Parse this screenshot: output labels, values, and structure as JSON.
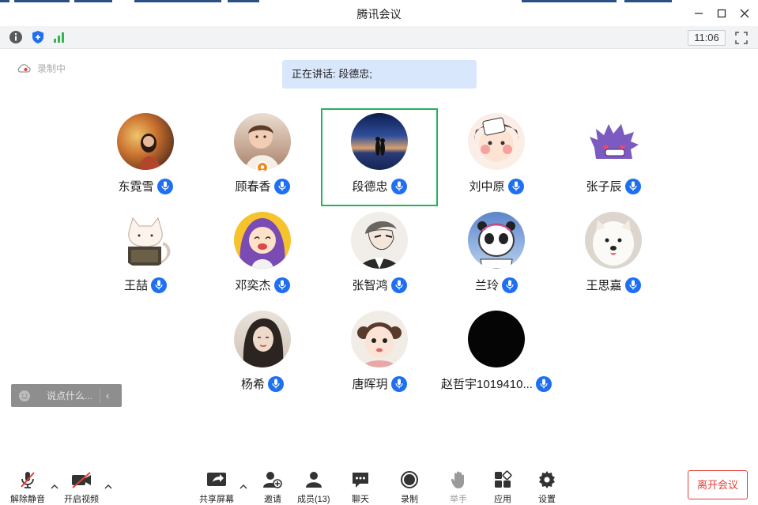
{
  "window": {
    "title": "腾讯会议"
  },
  "infobar": {
    "time": "11:06"
  },
  "recording": {
    "label": "录制中"
  },
  "speaking": {
    "text": "正在讲话: 段德忠;"
  },
  "participants": [
    {
      "name": "东霓雪",
      "avatar": "photo-girl-autumn"
    },
    {
      "name": "顾春香",
      "avatar": "photo-baby"
    },
    {
      "name": "段德忠",
      "avatar": "photo-couple-sunset"
    },
    {
      "name": "刘中原",
      "avatar": "cartoon-girl"
    },
    {
      "name": "张子辰",
      "avatar": "purple-ghost"
    },
    {
      "name": "王喆",
      "avatar": "cartoon-cat"
    },
    {
      "name": "邓奕杰",
      "avatar": "anime-purple-hair"
    },
    {
      "name": "张智鸿",
      "avatar": "sketch-man"
    },
    {
      "name": "兰玲",
      "avatar": "panda-mascot"
    },
    {
      "name": "王思嘉",
      "avatar": "white-dog"
    },
    {
      "name": "杨希",
      "avatar": "photo-woman"
    },
    {
      "name": "唐晖玥",
      "avatar": "photo-child"
    },
    {
      "name": "赵哲宇1019410...",
      "avatar": "black"
    }
  ],
  "chat": {
    "placeholder": "说点什么..."
  },
  "toolbar": {
    "unmute": "解除静音",
    "start_video": "开启视频",
    "share_screen": "共享屏幕",
    "invite": "邀请",
    "members": "成员(13)",
    "chat": "聊天",
    "record": "录制",
    "raise_hand": "举手",
    "apps": "应用",
    "settings": "设置",
    "leave": "离开会议"
  },
  "colors": {
    "accent": "#1e6ff1",
    "active_border": "#24b35b",
    "leave": "#e2403a",
    "banner": "#d8e7fb"
  }
}
